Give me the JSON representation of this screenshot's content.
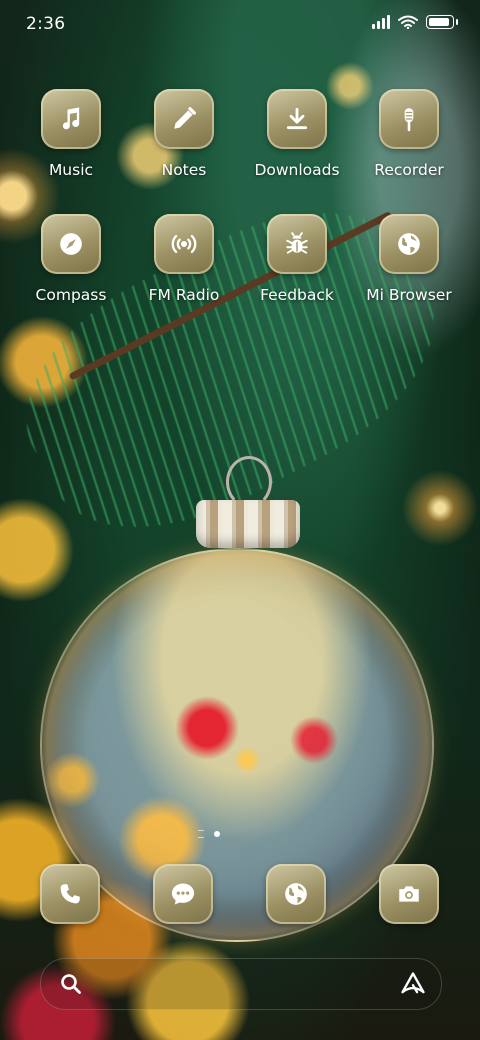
{
  "status_bar": {
    "time": "2:36"
  },
  "apps": [
    {
      "label": "Music",
      "icon": "music-note-icon"
    },
    {
      "label": "Notes",
      "icon": "pencil-icon"
    },
    {
      "label": "Downloads",
      "icon": "download-icon"
    },
    {
      "label": "Recorder",
      "icon": "microphone-icon"
    },
    {
      "label": "Compass",
      "icon": "compass-icon"
    },
    {
      "label": "FM Radio",
      "icon": "radio-broadcast-icon"
    },
    {
      "label": "Feedback",
      "icon": "bug-icon"
    },
    {
      "label": "Mi Browser",
      "icon": "globe-icon"
    }
  ],
  "dock": [
    {
      "icon": "phone-icon"
    },
    {
      "icon": "message-bubble-icon"
    },
    {
      "icon": "globe-icon"
    },
    {
      "icon": "camera-icon"
    }
  ],
  "search_bar": {
    "left_icon": "search-icon",
    "right_icon": "assistant-icon"
  },
  "colors": {
    "icon_gold": "#a89d6c",
    "text": "#ffffff"
  }
}
